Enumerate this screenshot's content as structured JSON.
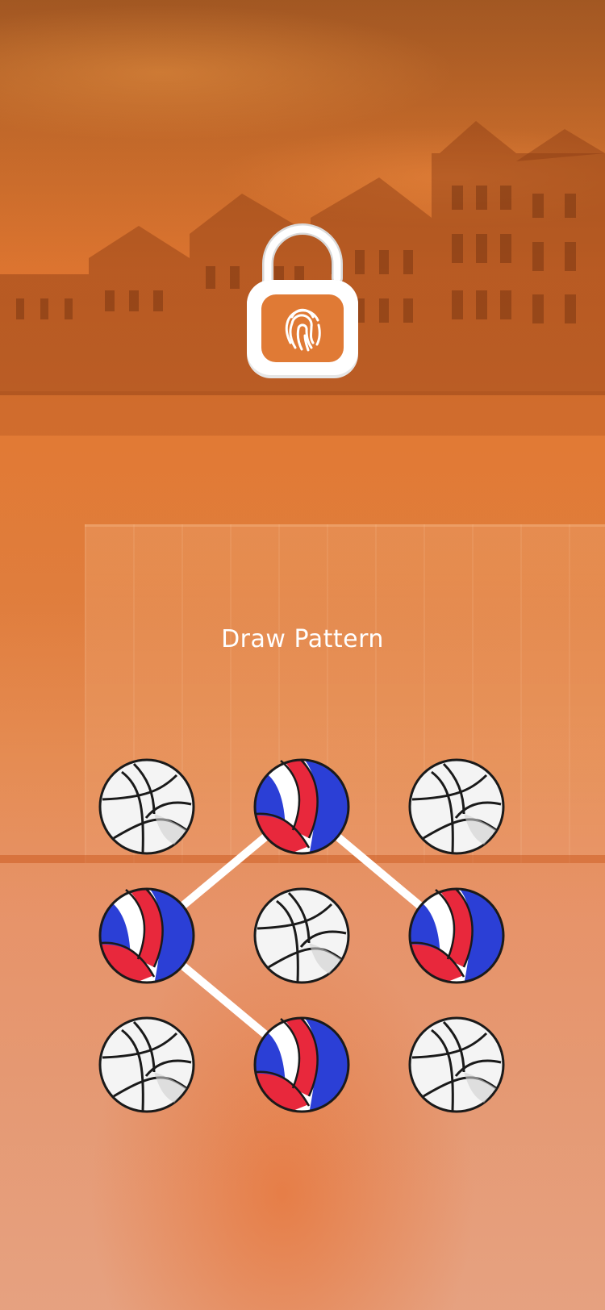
{
  "prompt": {
    "title": "Draw Pattern"
  },
  "icons": {
    "lock": "fingerprint-padlock-icon",
    "dot": "volleyball-icon"
  },
  "pattern": {
    "dots": [
      {
        "id": 1,
        "selected": false
      },
      {
        "id": 2,
        "selected": true
      },
      {
        "id": 3,
        "selected": false
      },
      {
        "id": 4,
        "selected": true
      },
      {
        "id": 5,
        "selected": false
      },
      {
        "id": 6,
        "selected": true
      },
      {
        "id": 7,
        "selected": false
      },
      {
        "id": 8,
        "selected": true
      },
      {
        "id": 9,
        "selected": false
      }
    ],
    "path": [
      6,
      2,
      4,
      8
    ]
  },
  "colors": {
    "accent_orange": "#e07a35",
    "path_line": "#ffffff",
    "ball_white": "#f2f2f2",
    "ball_red": "#e8283c",
    "ball_blue": "#2b3fd6"
  }
}
